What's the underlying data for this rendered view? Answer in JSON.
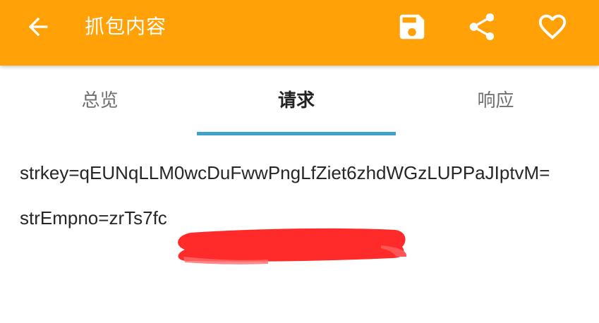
{
  "appbar": {
    "title": "抓包内容",
    "background": "#FFA107"
  },
  "icons": {
    "back": "arrow-left-icon",
    "save": "floppy-disk-icon",
    "share": "share-icon",
    "favorite": "heart-outline-icon"
  },
  "tabs": {
    "items": [
      {
        "label": "总览"
      },
      {
        "label": "请求"
      },
      {
        "label": "响应"
      }
    ],
    "selected": "请求",
    "indicator_color": "#3EA2C9"
  },
  "request": {
    "params": [
      {
        "text": "strkey=qEUNqLLM0wcDuFwwPngLfZiet6zhdWGzLUPPaJIptvM="
      },
      {
        "text": "strEmpno=zrTs7fc"
      }
    ]
  },
  "redaction": {
    "color": "#FF2A2A"
  }
}
